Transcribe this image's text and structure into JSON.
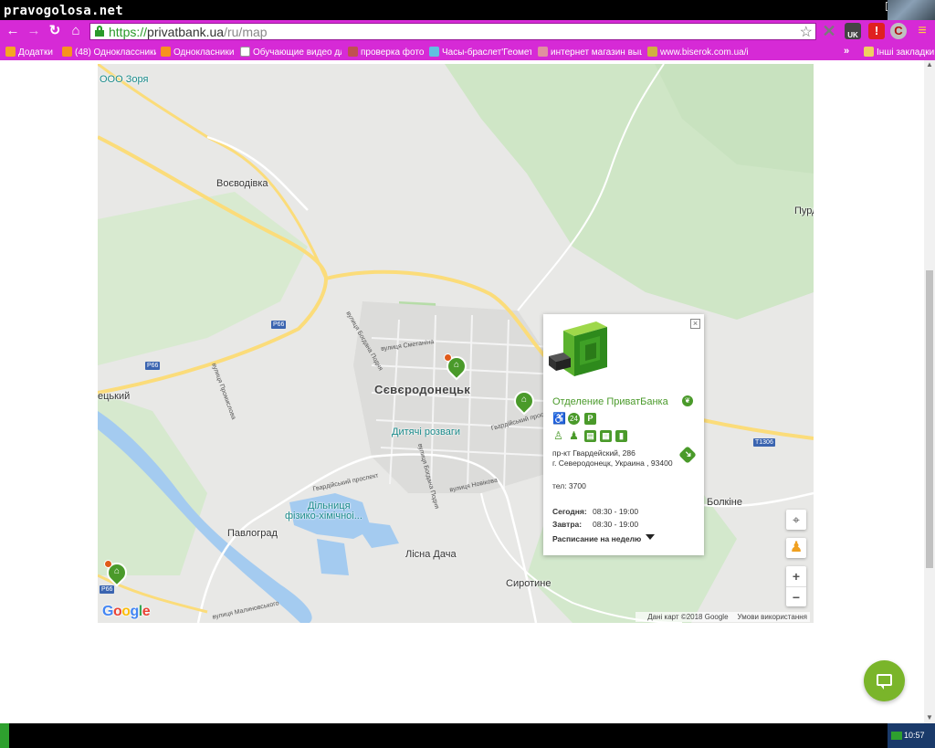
{
  "watermark": "pravogolosa.net",
  "browser": {
    "url_scheme": "https://",
    "url_host": "privatbank.ua",
    "url_path": "/ru/map",
    "toolbar_icons": [
      "back-icon",
      "forward-icon",
      "reload-icon",
      "home-icon",
      "lock-icon",
      "star-icon"
    ],
    "extensions": [
      "x-icon",
      "uk-extension-icon",
      "red-extension-icon",
      "c-extension-icon",
      "menu-icon"
    ],
    "ext_uk_label": "UK",
    "bookmarks": [
      {
        "label": "Додатки",
        "color": "#f5a623"
      },
      {
        "label": "(48) Одноклассники",
        "color": "#f7931e"
      },
      {
        "label": "Однокласники",
        "color": "#f7931e"
      },
      {
        "label": "Обучающие видео дл",
        "color": "#ffffff"
      },
      {
        "label": "проверка фото",
        "color": "#c05050"
      },
      {
        "label": "Часы-браслет'Геометр",
        "color": "#60c0e0"
      },
      {
        "label": "интернет магазин выш",
        "color": "#e090a0"
      },
      {
        "label": "www.biserok.com.ua/in",
        "color": "#d0b040"
      }
    ],
    "bookmarks_more": "»",
    "other_bookmarks": "Інші закладки"
  },
  "map": {
    "places": {
      "ooo_zorya": "ООО Зоря",
      "voievodivka": "Воєводівка",
      "purd": "Пурд",
      "sievierodonetsk": "Сєвєродонецьк",
      "tsky": "ецький",
      "dytiachi_rozvahy": "Дитячі розваги",
      "dilnytsia_1": "Дільниця",
      "dilnytsia_2": "фізико-хімічноі...",
      "pavlohrad": "Павлоград",
      "lisna_dacha": "Лісна Дача",
      "syrotyne": "Сиротине",
      "bolkine": "Болкіне"
    },
    "roads": {
      "p66_a": "P66",
      "p66_b": "P66",
      "p66_c": "P66",
      "t1306": "T1306"
    },
    "streets": {
      "smetanina": "вулиця Сметаніна",
      "bohdana": "вулиця Богдана Подня",
      "hvardiiskyi": "Гвардійський просп",
      "hvardiiskyi_2": "Гвардійський проспект",
      "novikova": "вулиця Новікова",
      "promyslova": "вулиця Промислова",
      "bohdana_2": "вулиця Богдана Подня",
      "malynovskoho": "вулиця Малиновського"
    },
    "google_logo": "Google",
    "attribution": "Дані карт ©2018 Google",
    "terms": "Умови використання",
    "zoom_in": "+",
    "zoom_out": "−"
  },
  "popup": {
    "close": "×",
    "title": "Отделение ПриватБанка",
    "facility_icons": [
      "wheelchair-icon",
      "atm-icon",
      "parking-icon",
      "person-icon",
      "group-icon",
      "cashier-icon",
      "terminal-icon",
      "safe-icon"
    ],
    "parking_label": "P",
    "address_line1": "пр-кт Гвардейский, 286",
    "address_line2": "г. Северодонецк, Украина , 93400",
    "phone": "тел: 3700",
    "today_label": "Сегодня:",
    "today_hours": "08:30 - 19:00",
    "tomorrow_label": "Завтра:",
    "tomorrow_hours": "08:30 - 19:00",
    "week_link": "Расписание на неделю"
  },
  "taskbar": {
    "clock": "10:57"
  },
  "colors": {
    "brand_green": "#4a9a2a",
    "chrome_magenta": "#d62ad6",
    "chat_green": "#7ab52a"
  }
}
